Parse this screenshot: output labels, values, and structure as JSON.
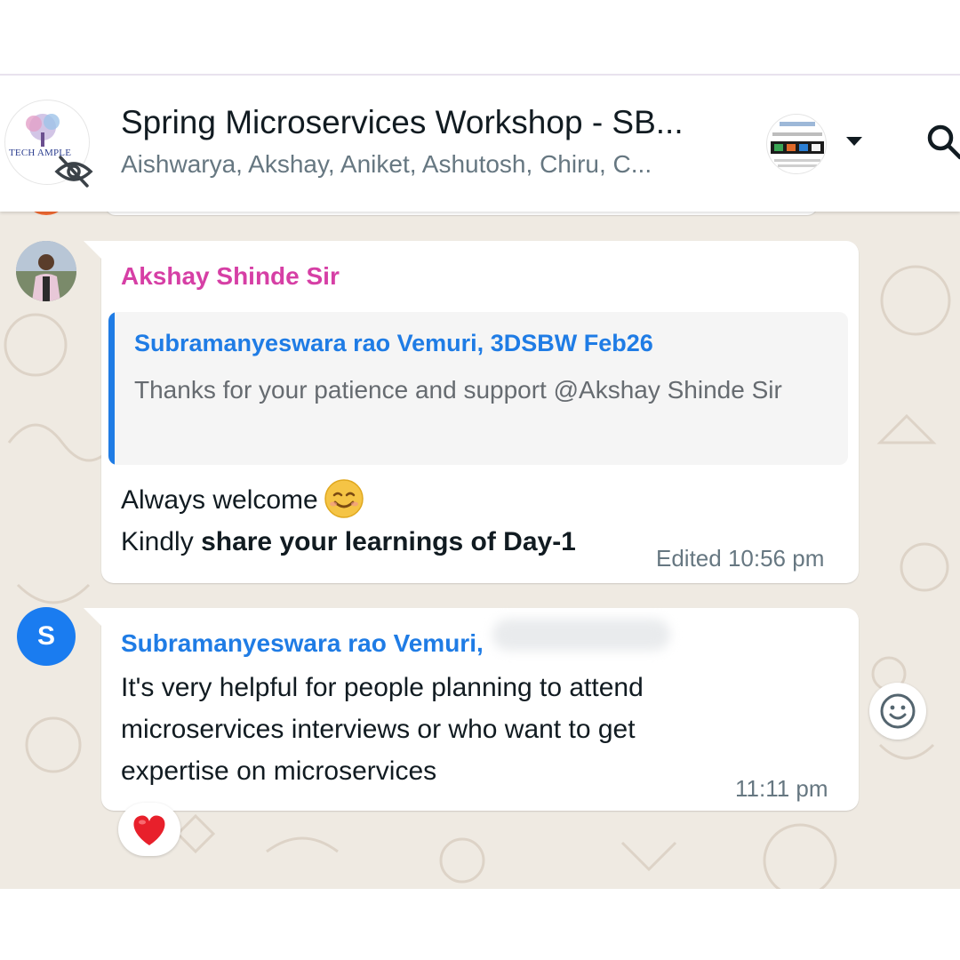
{
  "header": {
    "title": "Spring Microservices Workshop - SB...",
    "members": "Aishwarya, Akshay, Aniket, Ashutosh, Chiru, C...",
    "group_logo_text": "TECH AMPLE"
  },
  "messages": [
    {
      "sender": "Akshay Shinde Sir",
      "sender_color": "#d63fa5",
      "quote": {
        "author": "Subramanyeswara rao Vemuri, 3DSBW Feb26",
        "text": "Thanks for your patience and support @Akshay Shinde Sir"
      },
      "line1": "Always welcome",
      "line2_prefix": "Kindly",
      "line2_bold": "share your learnings of Day-1",
      "meta": "Edited 10:56 pm"
    },
    {
      "sender": "Subramanyeswara rao Vemuri,",
      "sender_color": "#1f7ce5",
      "avatar_initial": "S",
      "text_lines": [
        "It's very helpful for people planning to attend",
        "microservices interviews or who want to get",
        "expertise on microservices"
      ],
      "time": "11:11 pm",
      "reaction": "heart"
    }
  ],
  "colors": {
    "chat_bg": "#efeae2",
    "accent_blue": "#1f7ce5",
    "avatar_blue": "#1a7cf0"
  }
}
